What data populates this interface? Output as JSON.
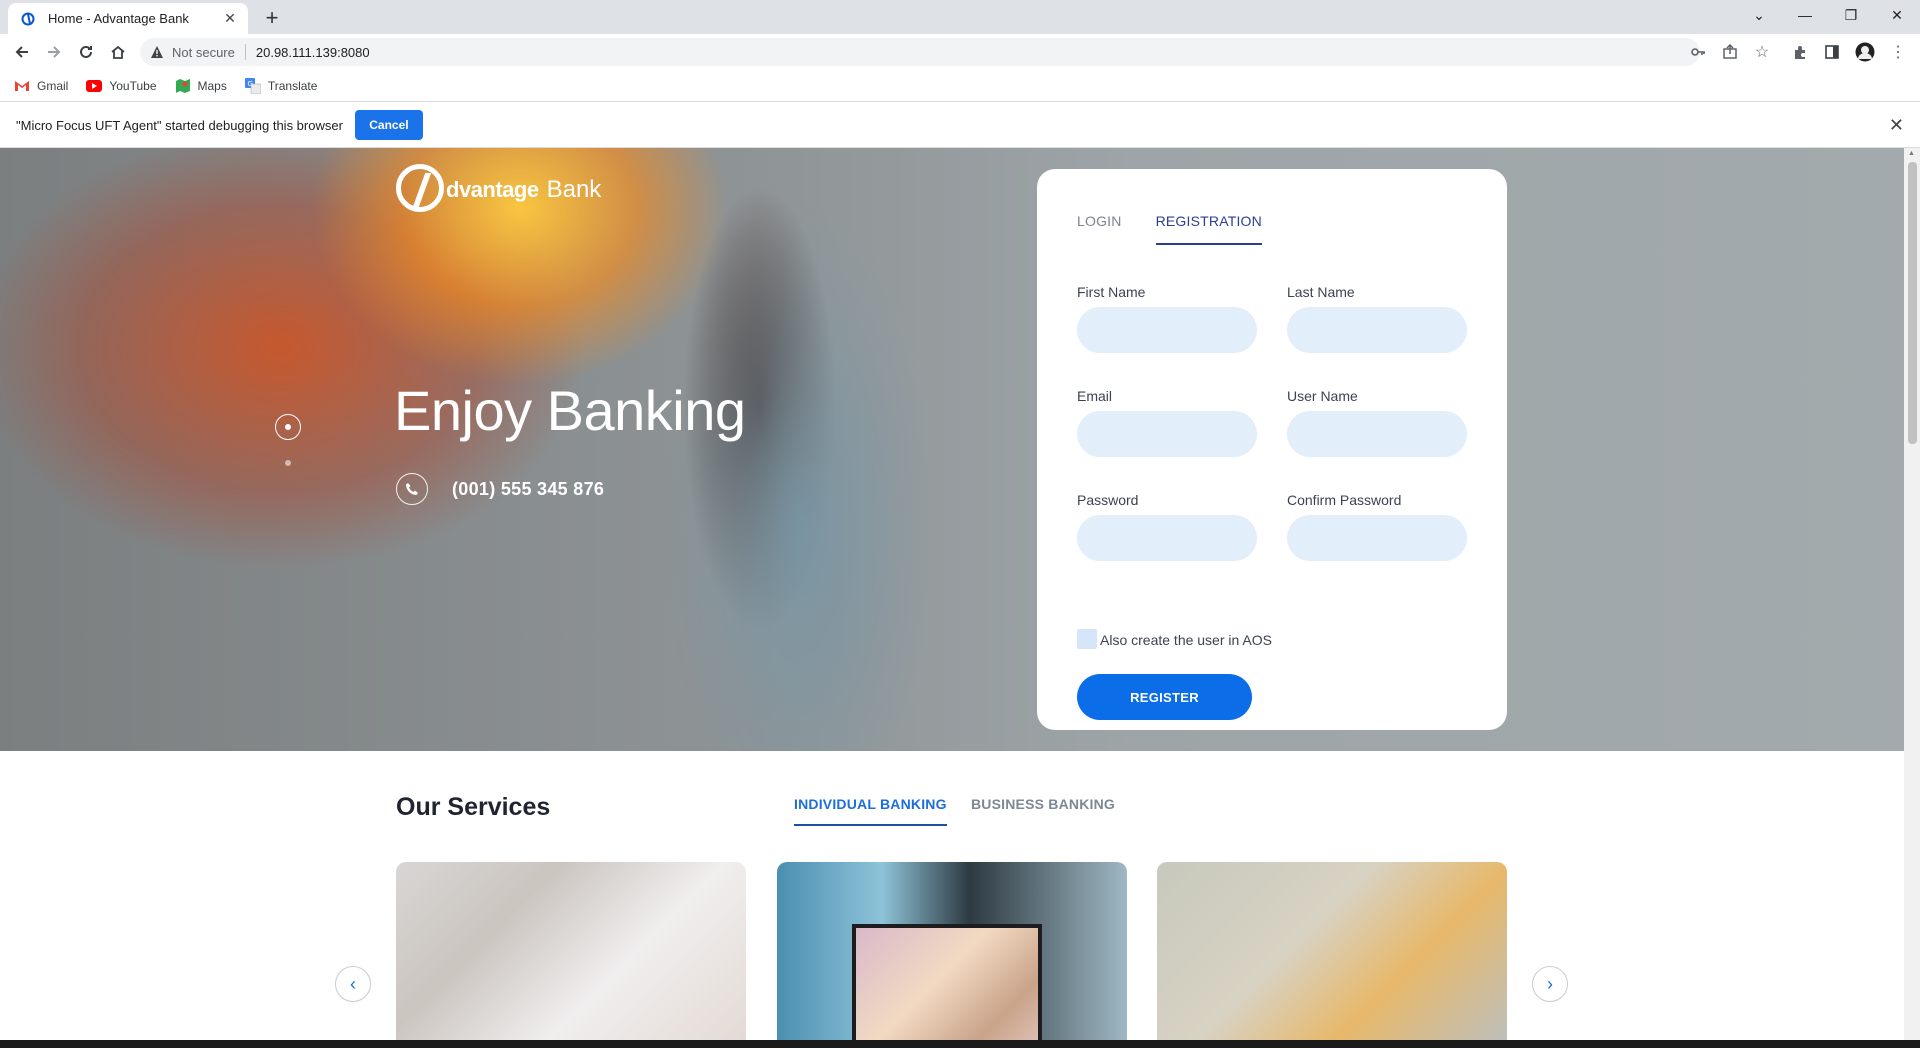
{
  "browser": {
    "tab_title": "Home - Advantage Bank",
    "new_tab": "+",
    "security": "Not secure",
    "url": "20.98.111.139:8080",
    "bookmarks": [
      {
        "label": "Gmail",
        "icon": "gmail-icon"
      },
      {
        "label": "YouTube",
        "icon": "youtube-icon"
      },
      {
        "label": "Maps",
        "icon": "maps-icon"
      },
      {
        "label": "Translate",
        "icon": "translate-icon"
      }
    ],
    "infobar": {
      "message": "\"Micro Focus UFT Agent\" started debugging this browser",
      "cancel_label": "Cancel"
    }
  },
  "hero": {
    "logo_word": "dvantage",
    "logo_bank": "Bank",
    "title": "Enjoy Banking",
    "phone": "(001) 555 345 876"
  },
  "form": {
    "tabs": {
      "login": "LOGIN",
      "registration": "REGISTRATION"
    },
    "active_tab": "REGISTRATION",
    "fields": {
      "first_name": {
        "label": "First Name",
        "value": ""
      },
      "last_name": {
        "label": "Last Name",
        "value": ""
      },
      "email": {
        "label": "Email",
        "value": ""
      },
      "user_name": {
        "label": "User Name",
        "value": ""
      },
      "password": {
        "label": "Password",
        "value": ""
      },
      "confirm_password": {
        "label": "Confirm Password",
        "value": ""
      }
    },
    "checkbox_label": "Also create the user in AOS",
    "checkbox_checked": false,
    "register_label": "REGISTER"
  },
  "services": {
    "title": "Our Services",
    "tabs": [
      "INDIVIDUAL BANKING",
      "BUSINESS BANKING"
    ],
    "active_tab": "INDIVIDUAL BANKING",
    "prev_arrow": "‹",
    "next_arrow": "›"
  },
  "colors": {
    "primary": "#0b6ee8",
    "tab_active": "#2c3e8f",
    "field_bg": "#e3eefb"
  }
}
